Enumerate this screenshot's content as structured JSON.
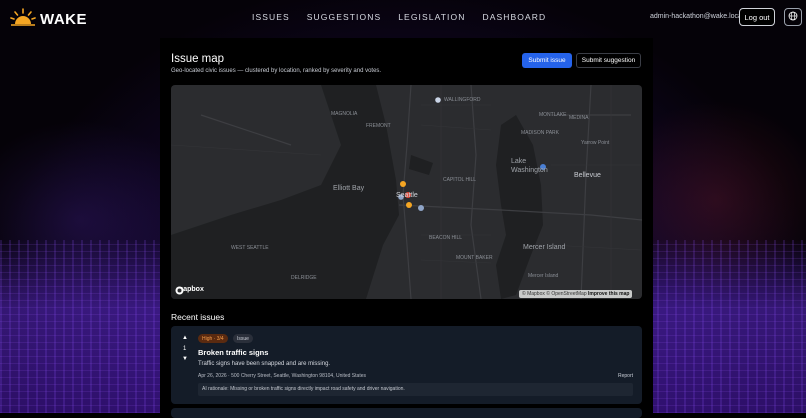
{
  "app": {
    "name": "WAKE"
  },
  "nav": {
    "items": [
      {
        "label": "ISSUES"
      },
      {
        "label": "SUGGESTIONS"
      },
      {
        "label": "LEGISLATION"
      },
      {
        "label": "DASHBOARD"
      }
    ]
  },
  "user": {
    "email": "admin-hackathon@wake.local",
    "logout_label": "Log out"
  },
  "page": {
    "title": "Issue map",
    "subtitle": "Geo-located civic issues — clustered by location, ranked by severity and votes.",
    "submit_issue_label": "Submit issue",
    "submit_suggestion_label": "Submit suggestion"
  },
  "map": {
    "labels": {
      "bellevue": "Bellevue",
      "lake_washington": "Lake Washington",
      "elliott_bay": "Elliott Bay",
      "seattle": "Seattle",
      "mercer_island": "Mercer Island",
      "magnolia": "MAGNOLIA",
      "wallingford": "WALLINGFORD",
      "fremont": "FREMONT",
      "capitol_hill": "CAPITOL HILL",
      "madison_park": "MADISON PARK",
      "medina": "MEDINA",
      "yarrow_point": "Yarrow Point",
      "montlake": "MONTLAKE",
      "west_seattle": "WEST SEATTLE",
      "beacon_hill": "BEACON HILL",
      "mount_baker": "MOUNT BAKER",
      "delridge": "DELRIDGE",
      "mercer_island_small": "Mercer Island"
    },
    "mapbox_label": "mapbox",
    "attribution_prefix": "© Mapbox © OpenStreetMap",
    "attribution_link": "Improve this map"
  },
  "recent": {
    "title": "Recent issues",
    "issues": [
      {
        "severity": "High · 3/4",
        "type": "Issue",
        "votes": "1",
        "title": "Broken traffic signs",
        "description": "Traffic signs have been snapped and are missing.",
        "date": "Apr 26, 2026",
        "address": "500 Cherry Street, Seattle, Washington 98104, United States",
        "report_label": "Report",
        "ai_rationale": "AI rationale: Missing or broken traffic signs directly impact road safety and driver navigation."
      }
    ]
  },
  "colors": {
    "accent": "#2563eb",
    "severity_high": "#f59e4b",
    "marker_orange": "#f5a623",
    "marker_blue": "#4a7fd4"
  },
  "icons": {
    "logo": "sun-icon",
    "globe": "globe-icon",
    "vote_up": "arrow-up-icon",
    "vote_down": "arrow-down-icon"
  }
}
